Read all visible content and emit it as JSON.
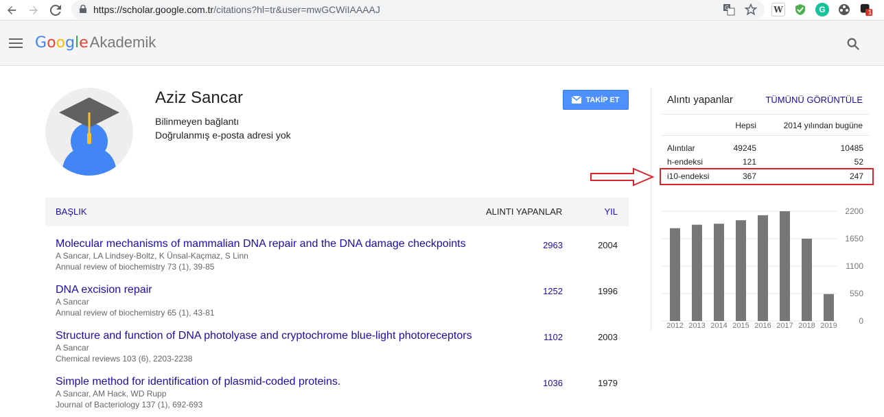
{
  "browser": {
    "url_host": "https://scholar.google.com.tr",
    "url_path": "/citations?hl=tr&user=mwGCWiIAAAAJ",
    "ext_badge": "1"
  },
  "header": {
    "logo_google": "Google",
    "logo_suffix": "Akademik"
  },
  "profile": {
    "name": "Aziz Sancar",
    "affiliation": "Bilinmeyen bağlantı",
    "email_status": "Doğrulanmış e-posta adresi yok",
    "follow_label": "TAKİP ET"
  },
  "table": {
    "col_title": "BAŞLIK",
    "col_cited": "ALINTI YAPANLAR",
    "col_year": "YIL",
    "rows": [
      {
        "title": "Molecular mechanisms of mammalian DNA repair and the DNA damage checkpoints",
        "authors": "A Sancar, LA Lindsey-Boltz, K Ünsal-Kaçmaz, S Linn",
        "venue": "Annual review of biochemistry 73 (1), 39-85",
        "cited": "2963",
        "year": "2004"
      },
      {
        "title": "DNA excision repair",
        "authors": "A Sancar",
        "venue": "Annual review of biochemistry 65 (1), 43-81",
        "cited": "1252",
        "year": "1996"
      },
      {
        "title": "Structure and function of DNA photolyase and cryptochrome blue-light photoreceptors",
        "authors": "A Sancar",
        "venue": "Chemical reviews 103 (6), 2203-2238",
        "cited": "1102",
        "year": "2003"
      },
      {
        "title": "Simple method for identification of plasmid-coded proteins.",
        "authors": "A Sancar, AM Hack, WD Rupp",
        "venue": "Journal of Bacteriology 137 (1), 692-693",
        "cited": "1036",
        "year": "1979"
      }
    ]
  },
  "stats": {
    "title": "Alıntı yapanlar",
    "view_all": "TÜMÜNÜ GÖRÜNTÜLE",
    "col_all": "Hepsi",
    "col_since": "2014 yılından bugüne",
    "rows": [
      {
        "label": "Alıntılar",
        "all": "49245",
        "since": "10485"
      },
      {
        "label": "h-endeksi",
        "all": "121",
        "since": "52"
      },
      {
        "label": "i10-endeksi",
        "all": "367",
        "since": "247"
      }
    ],
    "highlight_color": "#d9262d"
  },
  "chart_data": {
    "type": "bar",
    "categories": [
      "2012",
      "2013",
      "2014",
      "2015",
      "2016",
      "2017",
      "2018",
      "2019"
    ],
    "values": [
      1860,
      1930,
      1950,
      2020,
      2120,
      2200,
      1650,
      540
    ],
    "ylim": [
      0,
      2200
    ],
    "yticks": [
      "0",
      "550",
      "1100",
      "1650",
      "2200"
    ],
    "bar_color": "#777777",
    "grid": true
  }
}
